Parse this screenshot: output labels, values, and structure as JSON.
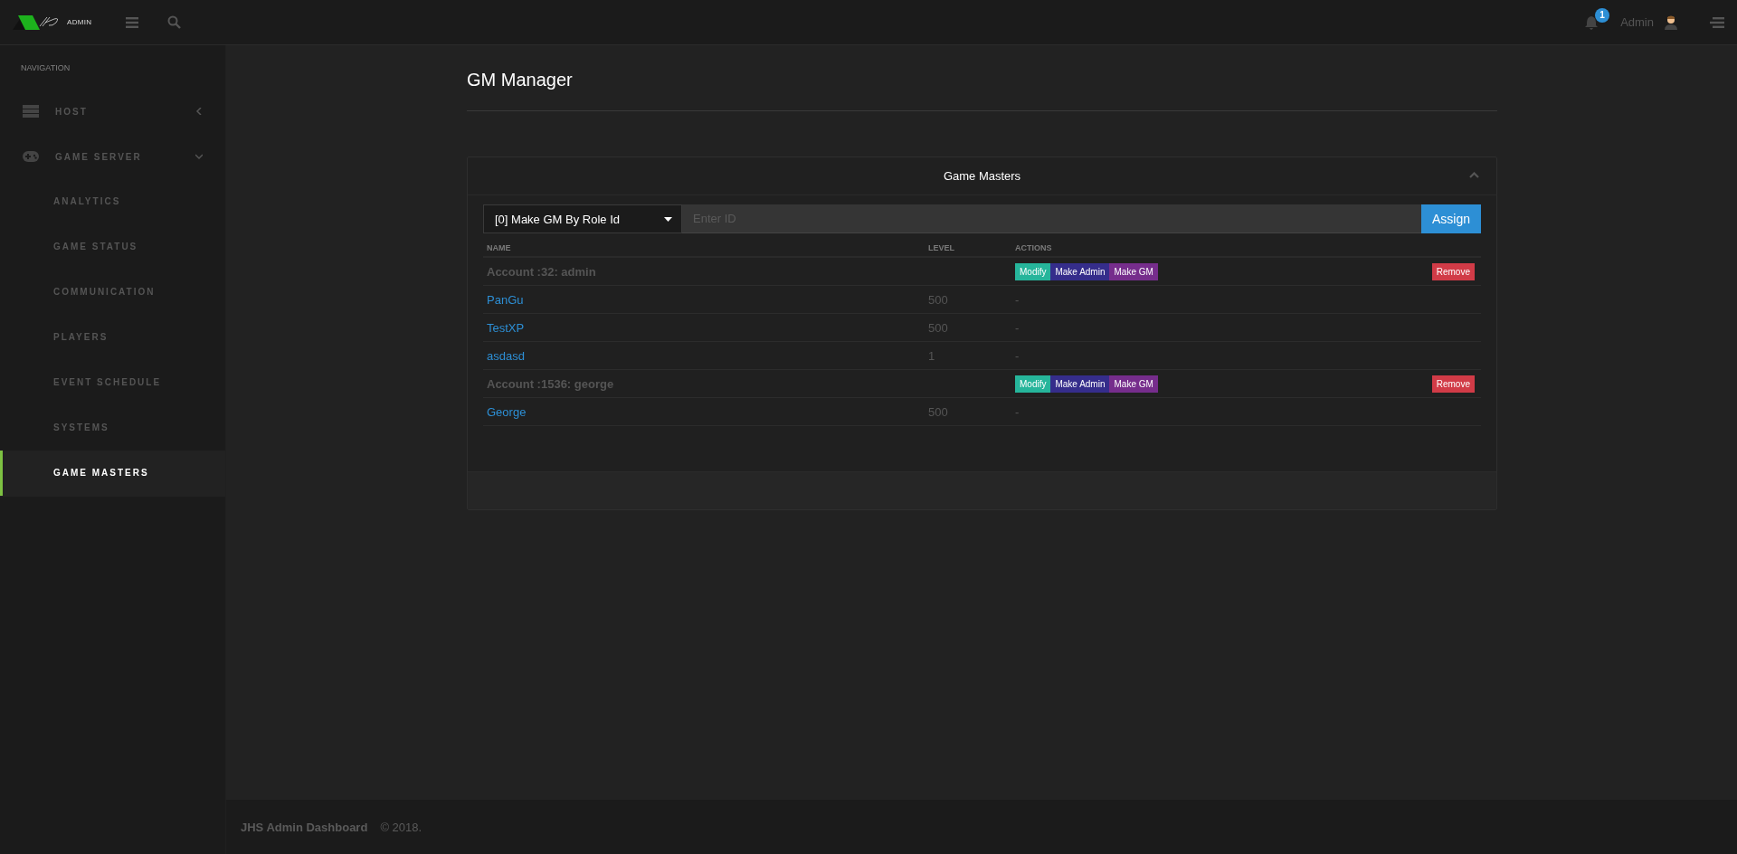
{
  "header": {
    "logo_text": "ADMIN",
    "notification_count": "1",
    "user_name": "Admin"
  },
  "sidebar": {
    "heading": "NAVIGATION",
    "items": [
      {
        "label": "HOST",
        "expanded": false
      },
      {
        "label": "GAME SERVER",
        "expanded": true,
        "children": [
          {
            "label": "ANALYTICS",
            "selected": false
          },
          {
            "label": "GAME STATUS",
            "selected": false
          },
          {
            "label": "COMMUNICATION",
            "selected": false
          },
          {
            "label": "PLAYERS",
            "selected": false
          },
          {
            "label": "EVENT SCHEDULE",
            "selected": false
          },
          {
            "label": "SYSTEMS",
            "selected": false
          },
          {
            "label": "GAME MASTERS",
            "selected": true
          }
        ]
      }
    ]
  },
  "page": {
    "title": "GM Manager"
  },
  "panel": {
    "title": "Game Masters",
    "expanded": true,
    "mode_select": "[0] Make GM By Role Id",
    "id_field": {
      "placeholder": "Enter ID"
    },
    "assign_button": "Assign",
    "table": {
      "columns": [
        "NAME",
        "LEVEL",
        "ACTIONS"
      ],
      "rows": [
        {
          "kind": "account",
          "name": "Account :32: admin",
          "actions": [
            "Modify",
            "Make Admin",
            "Make GM"
          ],
          "remove": "Remove"
        },
        {
          "kind": "player",
          "name": "PanGu",
          "level": "500",
          "action": "-"
        },
        {
          "kind": "player",
          "name": "TestXP",
          "level": "500",
          "action": "-"
        },
        {
          "kind": "player",
          "name": "asdasd",
          "level": "1",
          "action": "-"
        },
        {
          "kind": "account",
          "name": "Account :1536: george",
          "actions": [
            "Modify",
            "Make Admin",
            "Make GM"
          ],
          "remove": "Remove"
        },
        {
          "kind": "player",
          "name": "George",
          "level": "500",
          "action": "-"
        }
      ]
    }
  },
  "footer": {
    "brand": "JHS Admin Dashboard",
    "copyright": "© 2018."
  }
}
